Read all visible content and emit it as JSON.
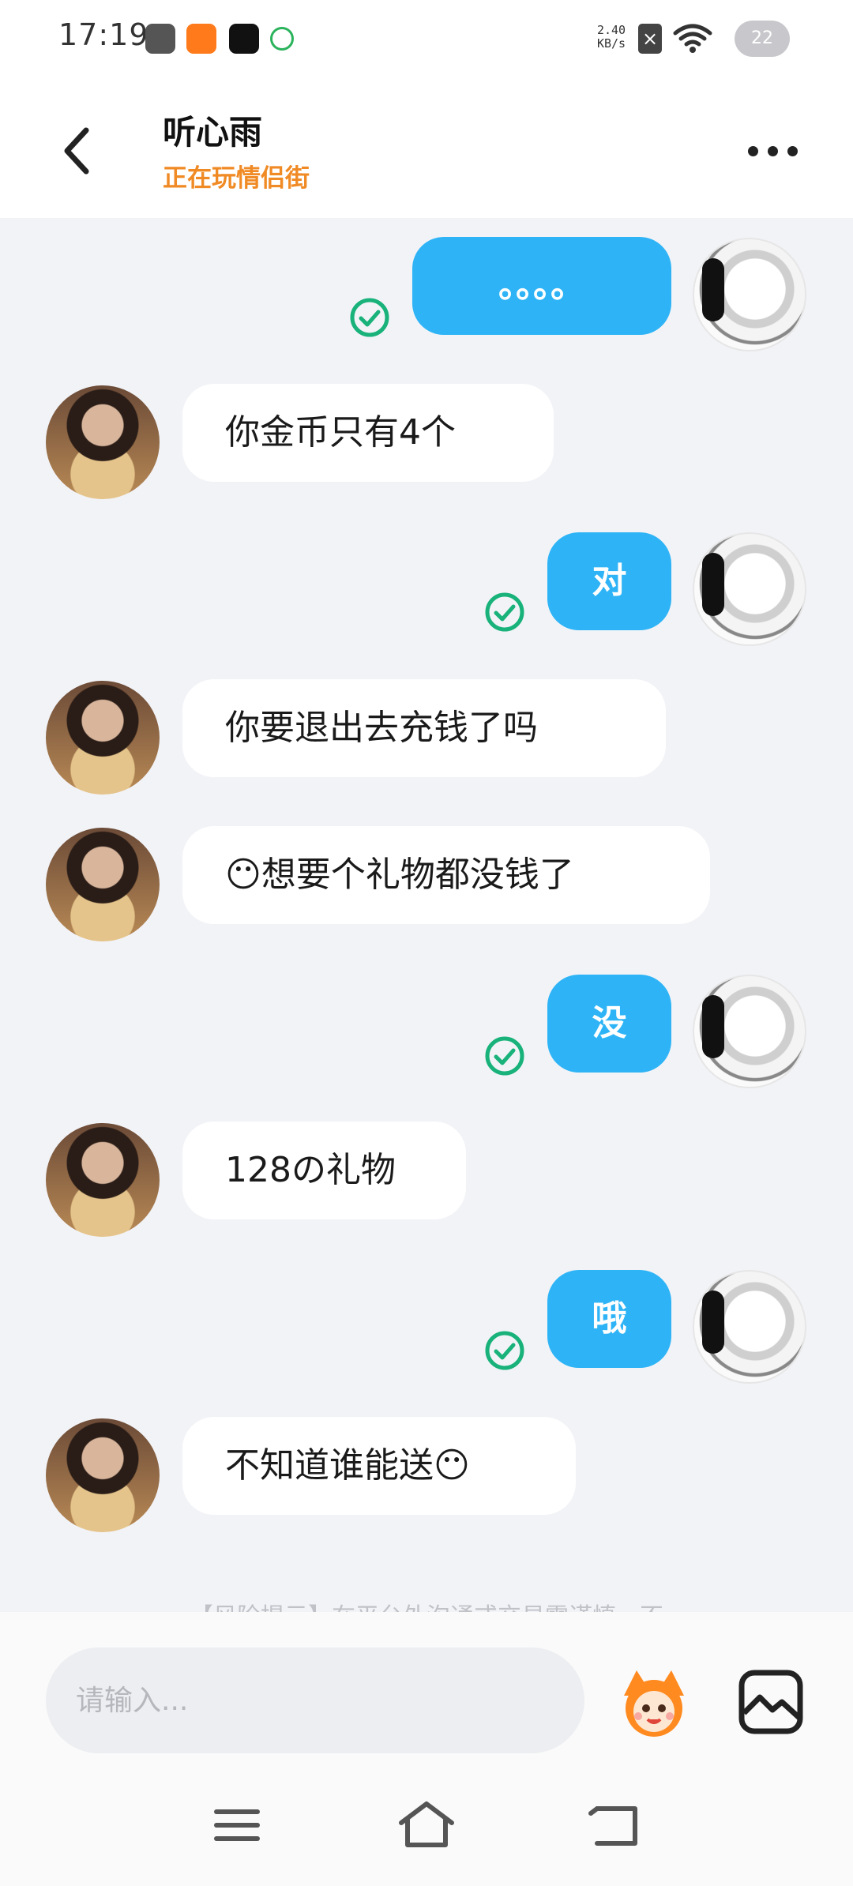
{
  "status_bar": {
    "time": "17:19",
    "net_speed_value": "2.40",
    "net_speed_unit": "KB/s",
    "battery": "22"
  },
  "header": {
    "contact_name": "听心雨",
    "contact_status": "正在玩情侣街",
    "accent_color": "#f08a24"
  },
  "messages": [
    {
      "sender": "self",
      "text": "。。。。",
      "read": true
    },
    {
      "sender": "other",
      "text": "你金币只有4个"
    },
    {
      "sender": "self",
      "text": "对",
      "read": true
    },
    {
      "sender": "other",
      "text": "你要退出去充钱了吗"
    },
    {
      "sender": "other",
      "text": "😶想要个礼物都没钱了"
    },
    {
      "sender": "self",
      "text": "没",
      "read": true
    },
    {
      "sender": "other",
      "text": "128の礼物"
    },
    {
      "sender": "self",
      "text": "哦",
      "read": true
    },
    {
      "sender": "other",
      "text": "不知道谁能送😶"
    }
  ],
  "risk_tip": "【风险提示】在平台外沟通或交易需谨慎，不",
  "input": {
    "placeholder": "请输入..."
  },
  "icons": {
    "back": "chevron-left-icon",
    "more": "more-dots-icon",
    "read": "check-circle-icon",
    "emoji": "emoji-mascot-icon",
    "image": "image-icon",
    "nav_menu": "menu-icon",
    "nav_home": "home-icon",
    "nav_back": "back-arrow-icon"
  },
  "colors": {
    "self_bubble": "#2eb4f6",
    "other_bubble": "#ffffff",
    "read_check": "#18b27a",
    "chat_bg": "#f2f3f7"
  }
}
